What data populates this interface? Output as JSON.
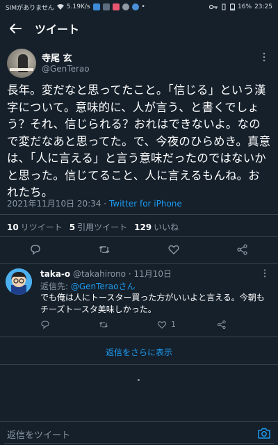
{
  "status_bar": {
    "carrier": "SIMがありません",
    "speed": "5.19K/s",
    "battery": "16%",
    "time": "23:25"
  },
  "topbar": {
    "title": "ツイート"
  },
  "tweet": {
    "name": "寺尾 玄",
    "handle": "@GenTerao",
    "text": "長年。変だなと思ってたこと。「信じる」という漢字について。意味的に、人が言う、と書くでしょう？それ、信じられる？おれはできないよ。なので変だなあと思ってた。で、今夜のひらめき。真意は、「人に言える」と言う意味だったのではないかと思った。信じてること、人に言えるもんね。おれたち。",
    "datetime": "2021年11月10日 20:34",
    "separator": " · ",
    "source": "Twitter for iPhone",
    "stats": {
      "retweets_count": "10",
      "retweets_label": "リツイート",
      "quotes_count": "5",
      "quotes_label": "引用ツイート",
      "likes_count": "129",
      "likes_label": "いいね"
    }
  },
  "reply": {
    "name": "taka-o",
    "handle": "@takahirono",
    "date": "· 11月10日",
    "reply_to_label": "返信先: ",
    "reply_to_user": "@GenTeraoさん",
    "text": "でも俺は人にトースター買った方がいいよと言える。今朝もチーズトースタ美味しかった。",
    "likes_count": "1"
  },
  "show_more_replies": "返信をさらに表示",
  "compose": {
    "placeholder": "返信をツイート"
  },
  "colors": {
    "background": "#15202b",
    "accent": "#1d9bf0",
    "muted": "#8b98a5",
    "divider": "#38444d"
  },
  "icons": [
    "back-arrow-icon",
    "more-vertical-icon",
    "reply-icon",
    "retweet-icon",
    "like-icon",
    "share-icon",
    "camera-icon"
  ]
}
